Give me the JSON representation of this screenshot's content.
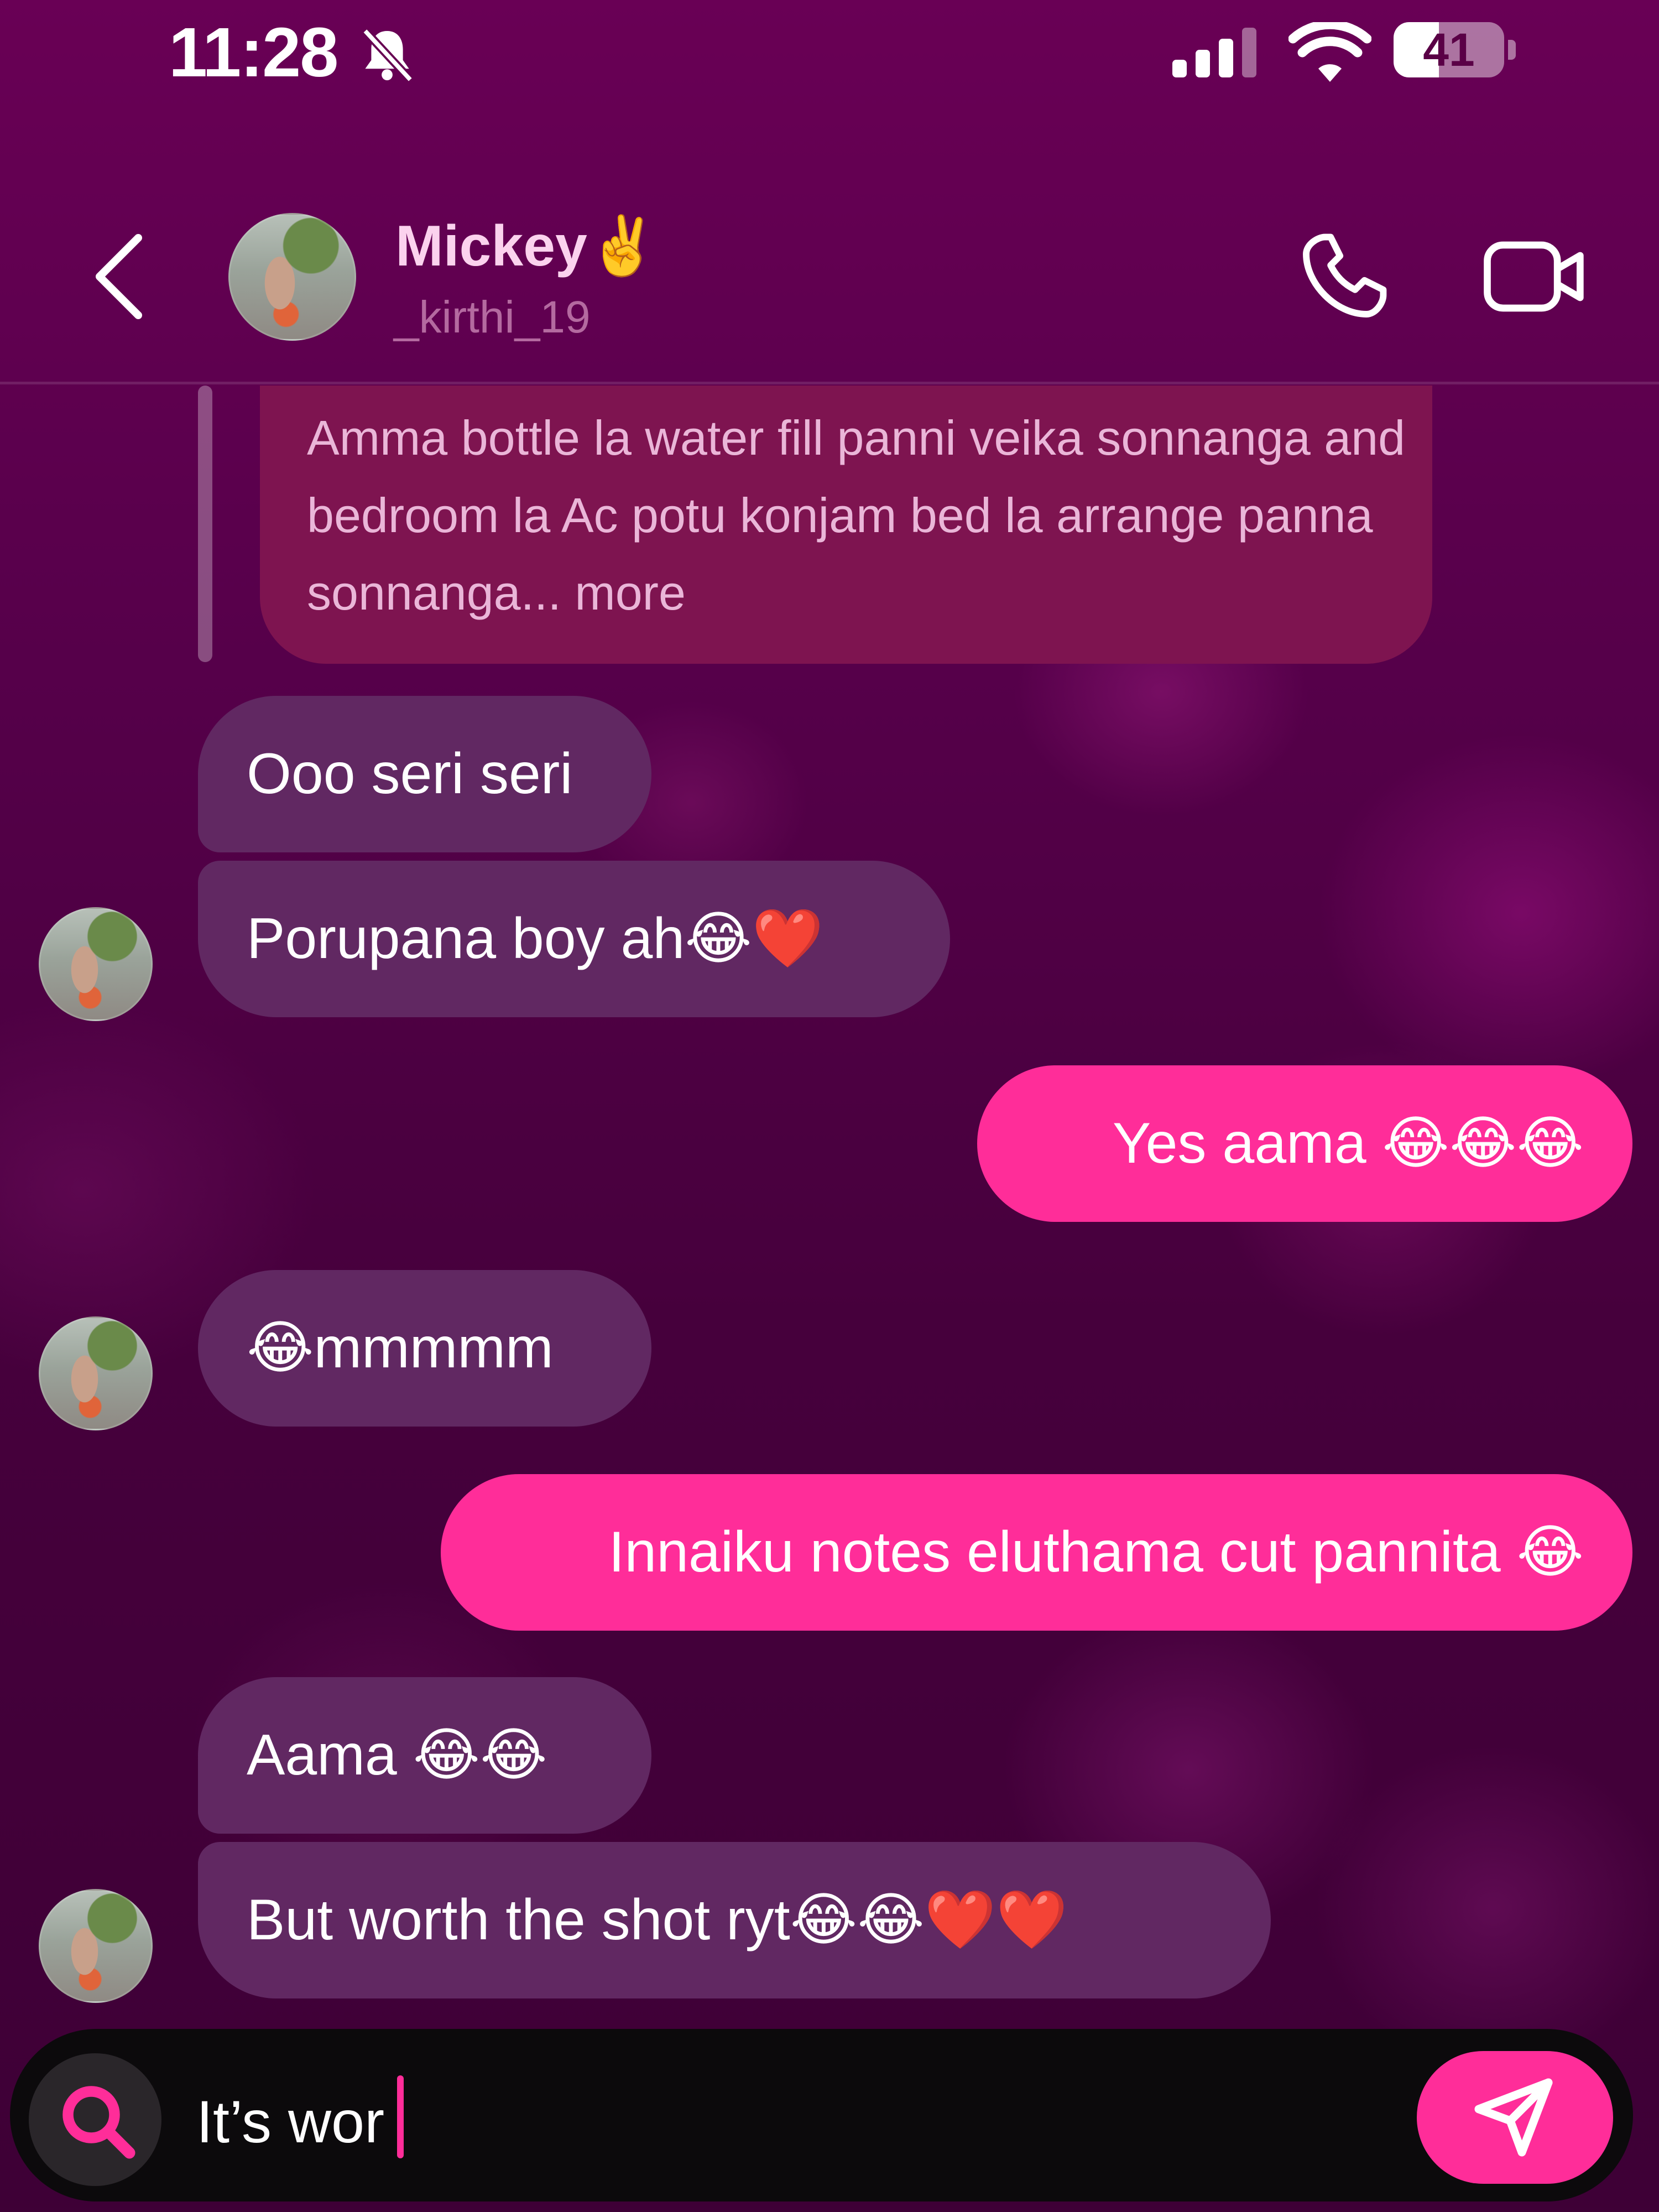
{
  "status_bar": {
    "time": "11:28",
    "battery": "41",
    "battery_level": 0.41,
    "silent_icon": "bell-slash-icon",
    "signal_icon": "cellular-signal-icon",
    "wifi_icon": "wifi-icon"
  },
  "header": {
    "name": "Mickey",
    "emoji": "✌️",
    "username": "_kirthi_19",
    "back_icon": "chevron-left-icon",
    "call_icon": "phone-icon",
    "video_icon": "video-camera-icon"
  },
  "messages": [
    {
      "from": "them",
      "type": "reply-quote",
      "text": "Amma bottle la water fill panni veika sonnanga and bedroom la Ac potu konjam bed la arrange panna sonnanga... more"
    },
    {
      "from": "them",
      "text": "Ooo seri seri"
    },
    {
      "from": "them",
      "text": "Porupana boy ah😂❤️"
    },
    {
      "from": "me",
      "text": "Yes aama 😂😂😂"
    },
    {
      "from": "them",
      "text": "😂mmmmm"
    },
    {
      "from": "me",
      "text": "Innaiku notes eluthama cut pannita 😂"
    },
    {
      "from": "them",
      "text": "Aama 😂😂"
    },
    {
      "from": "them",
      "text": "But worth the shot ryt😂😂❤️❤️"
    }
  ],
  "composer": {
    "value": "It’s wor",
    "search_icon": "search-icon",
    "send_icon": "send-icon"
  },
  "colors": {
    "accent": "#ff2d99",
    "incoming_bubble": "#612862",
    "reply_bubble": "#7e1450",
    "name": "#fbd2ee",
    "username": "#b46aa0"
  }
}
